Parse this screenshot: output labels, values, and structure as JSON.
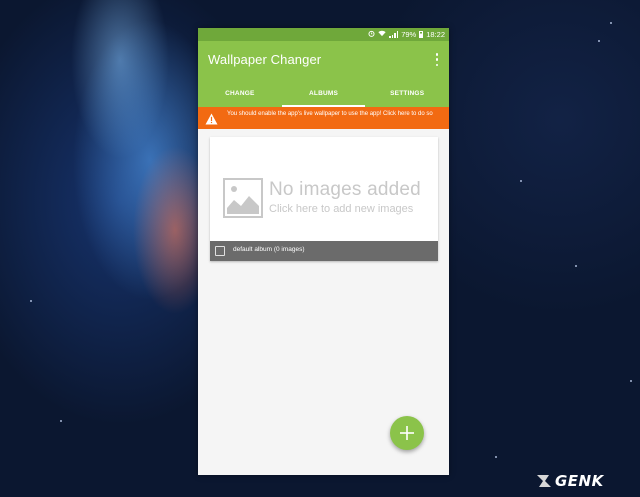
{
  "status_bar": {
    "battery": "79%",
    "time": "18:22"
  },
  "app_bar": {
    "title": "Wallpaper Changer"
  },
  "tabs": [
    {
      "label": "CHANGE",
      "active": false
    },
    {
      "label": "ALBUMS",
      "active": true
    },
    {
      "label": "SETTINGS",
      "active": false
    }
  ],
  "warning": {
    "text": "You should enable the app's live wallpaper to use the app! Click here to do so"
  },
  "album_card": {
    "empty_title": "No images added",
    "empty_hint": "Click here to add new images",
    "album_label": "default album (0 images)"
  },
  "colors": {
    "status_bar": "#6fa83a",
    "app_bar": "#8bc34a",
    "warning": "#f26a12",
    "album_footer": "#6b6b6b",
    "fab": "#8bc34a"
  },
  "icons": {
    "overflow": "more-vert-icon",
    "warning": "warning-icon",
    "placeholder": "image-placeholder-icon",
    "fab": "plus-icon"
  },
  "watermark": {
    "text": "GENK"
  }
}
